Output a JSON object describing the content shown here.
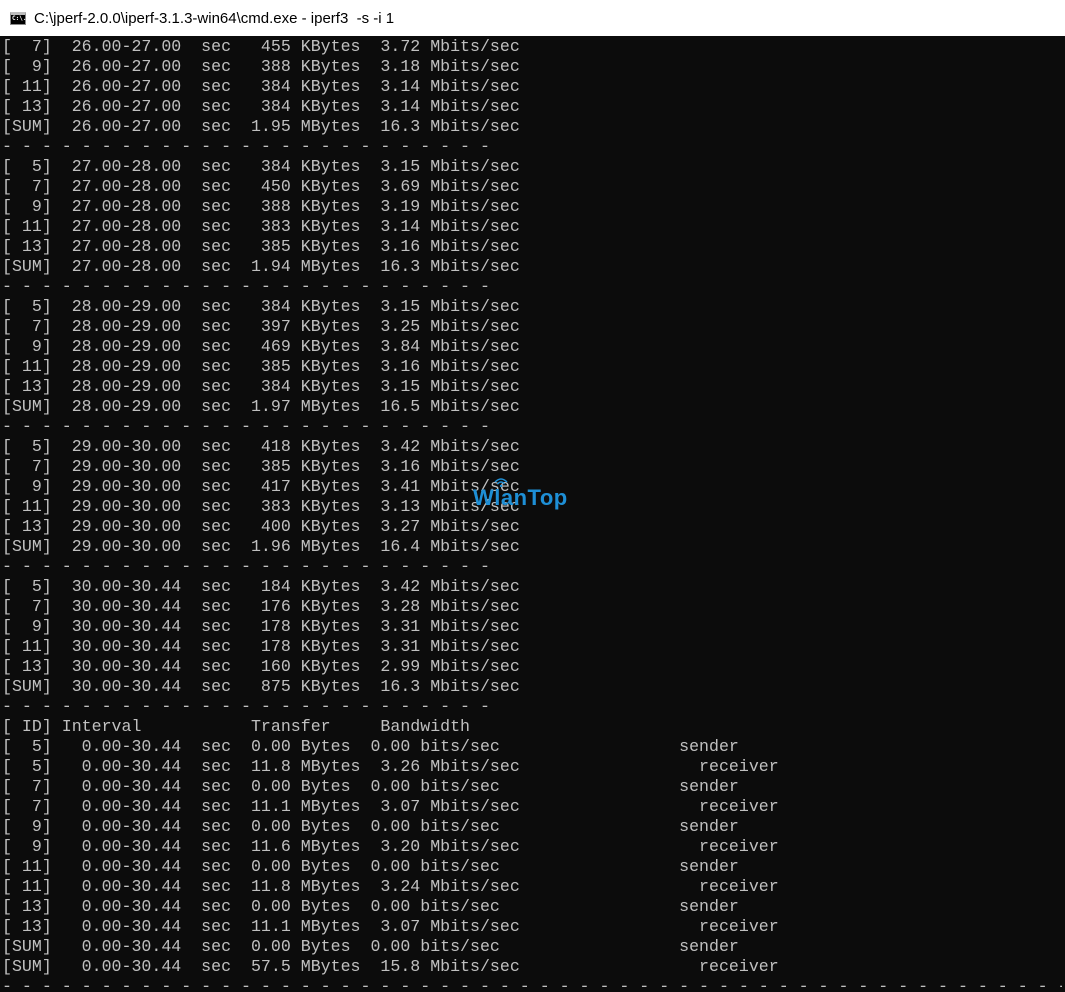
{
  "window": {
    "title": "C:\\jperf-2.0.0\\iperf-3.1.3-win64\\cmd.exe - iperf3  -s -i 1",
    "icon": "cmd-icon",
    "icon_text": "C:\\."
  },
  "console": {
    "lines": [
      "[  7]  26.00-27.00  sec   455 KBytes  3.72 Mbits/sec",
      "[  9]  26.00-27.00  sec   388 KBytes  3.18 Mbits/sec",
      "[ 11]  26.00-27.00  sec   384 KBytes  3.14 Mbits/sec",
      "[ 13]  26.00-27.00  sec   384 KBytes  3.14 Mbits/sec",
      "[SUM]  26.00-27.00  sec  1.95 MBytes  16.3 Mbits/sec",
      "- - - - - - - - - - - - - - - - - - - - - - - - -",
      "[  5]  27.00-28.00  sec   384 KBytes  3.15 Mbits/sec",
      "[  7]  27.00-28.00  sec   450 KBytes  3.69 Mbits/sec",
      "[  9]  27.00-28.00  sec   388 KBytes  3.19 Mbits/sec",
      "[ 11]  27.00-28.00  sec   383 KBytes  3.14 Mbits/sec",
      "[ 13]  27.00-28.00  sec   385 KBytes  3.16 Mbits/sec",
      "[SUM]  27.00-28.00  sec  1.94 MBytes  16.3 Mbits/sec",
      "- - - - - - - - - - - - - - - - - - - - - - - - -",
      "[  5]  28.00-29.00  sec   384 KBytes  3.15 Mbits/sec",
      "[  7]  28.00-29.00  sec   397 KBytes  3.25 Mbits/sec",
      "[  9]  28.00-29.00  sec   469 KBytes  3.84 Mbits/sec",
      "[ 11]  28.00-29.00  sec   385 KBytes  3.16 Mbits/sec",
      "[ 13]  28.00-29.00  sec   384 KBytes  3.15 Mbits/sec",
      "[SUM]  28.00-29.00  sec  1.97 MBytes  16.5 Mbits/sec",
      "- - - - - - - - - - - - - - - - - - - - - - - - -",
      "[  5]  29.00-30.00  sec   418 KBytes  3.42 Mbits/sec",
      "[  7]  29.00-30.00  sec   385 KBytes  3.16 Mbits/sec",
      "[  9]  29.00-30.00  sec   417 KBytes  3.41 Mbits/sec",
      "[ 11]  29.00-30.00  sec   383 KBytes  3.13 Mbits/sec",
      "[ 13]  29.00-30.00  sec   400 KBytes  3.27 Mbits/sec",
      "[SUM]  29.00-30.00  sec  1.96 MBytes  16.4 Mbits/sec",
      "- - - - - - - - - - - - - - - - - - - - - - - - -",
      "[  5]  30.00-30.44  sec   184 KBytes  3.42 Mbits/sec",
      "[  7]  30.00-30.44  sec   176 KBytes  3.28 Mbits/sec",
      "[  9]  30.00-30.44  sec   178 KBytes  3.31 Mbits/sec",
      "[ 11]  30.00-30.44  sec   178 KBytes  3.31 Mbits/sec",
      "[ 13]  30.00-30.44  sec   160 KBytes  2.99 Mbits/sec",
      "[SUM]  30.00-30.44  sec   875 KBytes  16.3 Mbits/sec",
      "- - - - - - - - - - - - - - - - - - - - - - - - -",
      "[ ID] Interval           Transfer     Bandwidth",
      "[  5]   0.00-30.44  sec  0.00 Bytes  0.00 bits/sec                  sender",
      "[  5]   0.00-30.44  sec  11.8 MBytes  3.26 Mbits/sec                  receiver",
      "[  7]   0.00-30.44  sec  0.00 Bytes  0.00 bits/sec                  sender",
      "[  7]   0.00-30.44  sec  11.1 MBytes  3.07 Mbits/sec                  receiver",
      "[  9]   0.00-30.44  sec  0.00 Bytes  0.00 bits/sec                  sender",
      "[  9]   0.00-30.44  sec  11.6 MBytes  3.20 Mbits/sec                  receiver",
      "[ 11]   0.00-30.44  sec  0.00 Bytes  0.00 bits/sec                  sender",
      "[ 11]   0.00-30.44  sec  11.8 MBytes  3.24 Mbits/sec                  receiver",
      "[ 13]   0.00-30.44  sec  0.00 Bytes  0.00 bits/sec                  sender",
      "[ 13]   0.00-30.44  sec  11.1 MBytes  3.07 Mbits/sec                  receiver",
      "[SUM]   0.00-30.44  sec  0.00 Bytes  0.00 bits/sec                  sender",
      "[SUM]   0.00-30.44  sec  57.5 MBytes  15.8 Mbits/sec                  receiver",
      "- - - - - - - - - - - - - - - - - - - - - - - - - - - - - - - - - - - - - - - - - - - - - - - - - - - - - - - - - -"
    ]
  },
  "watermark": {
    "text": "WlanTop",
    "color": "#1e8fd6",
    "icon": "wifi-icon"
  },
  "colors": {
    "console_background": "#0c0c0c",
    "console_text": "#c0c0c0",
    "titlebar_background": "#ffffff"
  }
}
